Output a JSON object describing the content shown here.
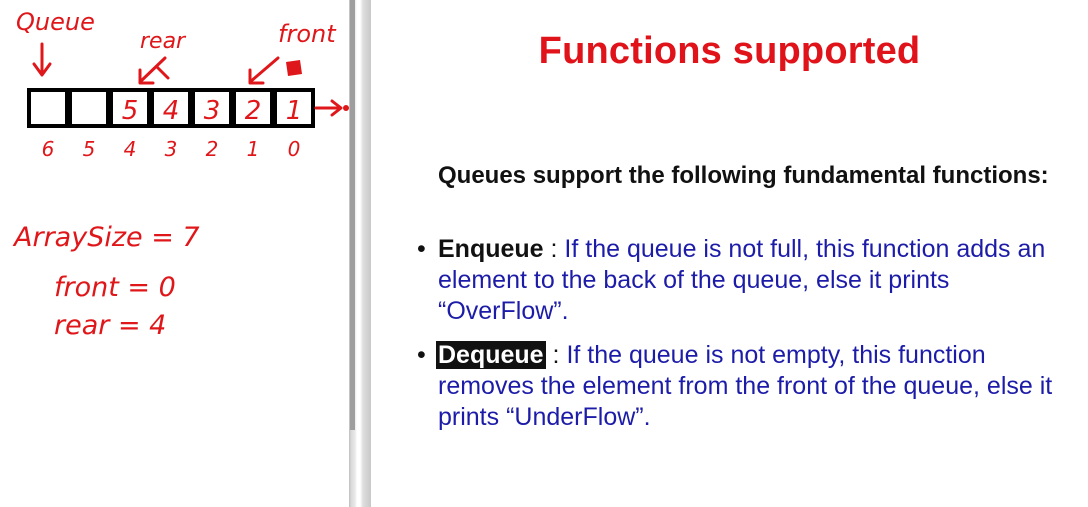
{
  "whiteboard": {
    "label_queue": "Queue",
    "label_rear": "rear",
    "label_front": "front",
    "cells": [
      "",
      "",
      "5",
      "4",
      "3",
      "2",
      "1"
    ],
    "indices": [
      "6",
      "5",
      "4",
      "3",
      "2",
      "1",
      "0"
    ],
    "notes": [
      "ArraySize = 7",
      "front = 0",
      "rear = 4"
    ]
  },
  "slide": {
    "title": "Functions supported",
    "intro": "Queues support the following fundamental functions:",
    "bullets": [
      {
        "term": "Enqueue",
        "separator": " : ",
        "text": "If the queue is not full, this function adds an element to the back of the queue, else it prints “OverFlow”."
      },
      {
        "term": "Dequeue",
        "separator": " : ",
        "text": "If the queue is not empty, this function removes the element from the front of the queue, else it prints “UnderFlow”."
      }
    ]
  },
  "colors": {
    "ink": "#e0171a",
    "title": "#e0121a",
    "body_text": "#1c1ca8"
  }
}
